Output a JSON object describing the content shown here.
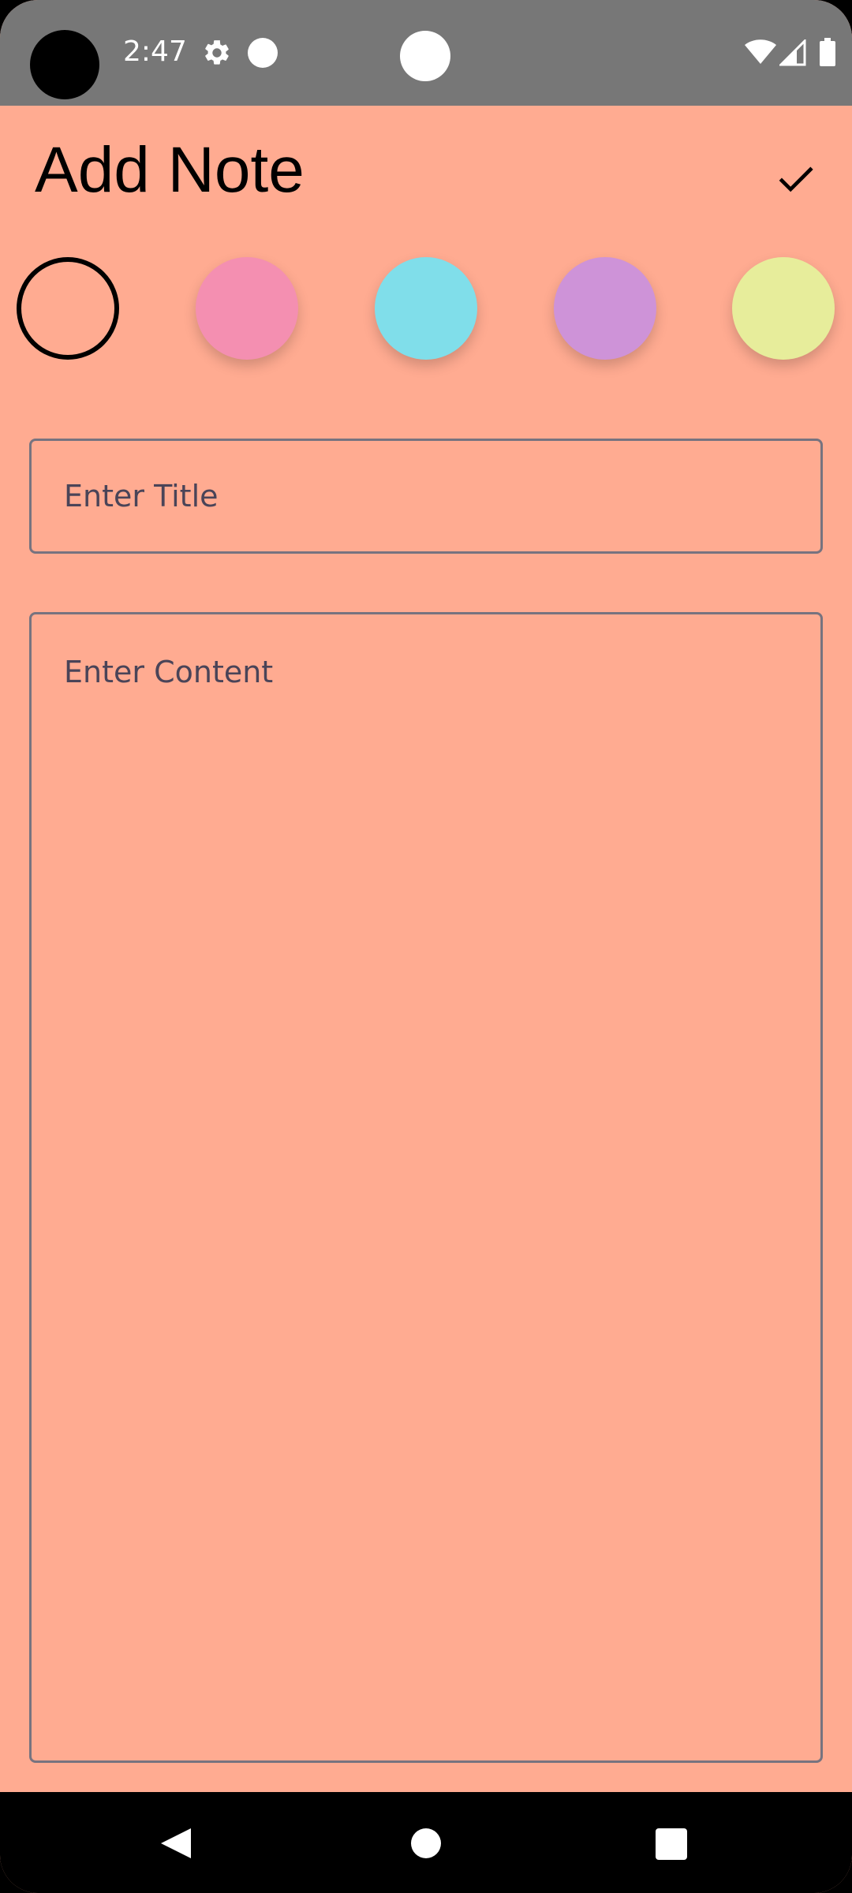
{
  "status_bar": {
    "time": "2:47",
    "icons": [
      "gear-icon",
      "notification-dot-icon",
      "wifi-icon",
      "cell-signal-icon",
      "battery-icon"
    ]
  },
  "header": {
    "title": "Add Note",
    "save_icon": "check-icon"
  },
  "color_picker": {
    "selected_index": 0,
    "colors": [
      "#ffab91",
      "#f48fb1",
      "#80deea",
      "#ce93d8",
      "#e7ed9b"
    ]
  },
  "form": {
    "title_placeholder": "Enter Title",
    "title_value": "",
    "content_placeholder": "Enter Content",
    "content_value": ""
  },
  "nav_bar": {
    "icons": [
      "back-icon",
      "home-icon",
      "recents-icon"
    ]
  },
  "theme": {
    "background": "#ffab91",
    "status_bar": "#777777",
    "field_border": "#77737f"
  }
}
